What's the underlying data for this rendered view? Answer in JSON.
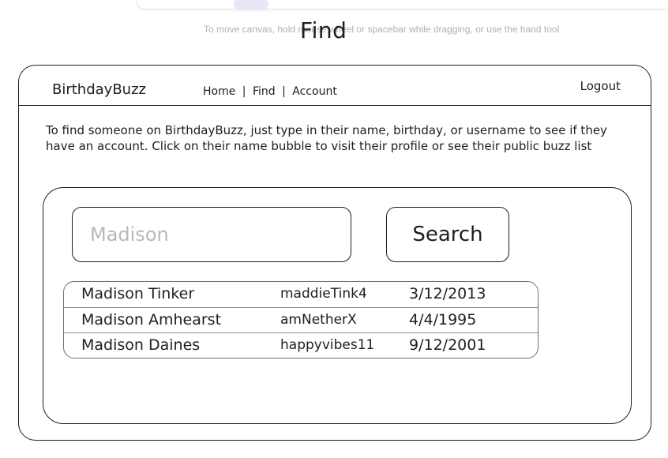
{
  "canvas": {
    "hint": "To move canvas, hold mouse wheel or spacebar while dragging, or use the hand tool",
    "title": "Find"
  },
  "header": {
    "brand": "BirthdayBuzz",
    "nav": [
      "Home",
      "Find",
      "Account"
    ],
    "separator": "|",
    "logout": "Logout"
  },
  "main": {
    "description": "To find someone on BirthdayBuzz, just type in their name, birthday, or username to see if they have an account.  Click on their name bubble to visit their profile or see their public buzz list",
    "search": {
      "value": "",
      "placeholder": "Madison",
      "button_label": "Search"
    },
    "results": [
      {
        "name": "Madison Tinker",
        "username": "maddieTink4",
        "birthday": "3/12/2013"
      },
      {
        "name": "Madison Amhearst",
        "username": "amNetherX",
        "birthday": "4/4/1995"
      },
      {
        "name": "Madison Daines",
        "username": "happyvibes11",
        "birthday": "9/12/2001"
      }
    ]
  }
}
